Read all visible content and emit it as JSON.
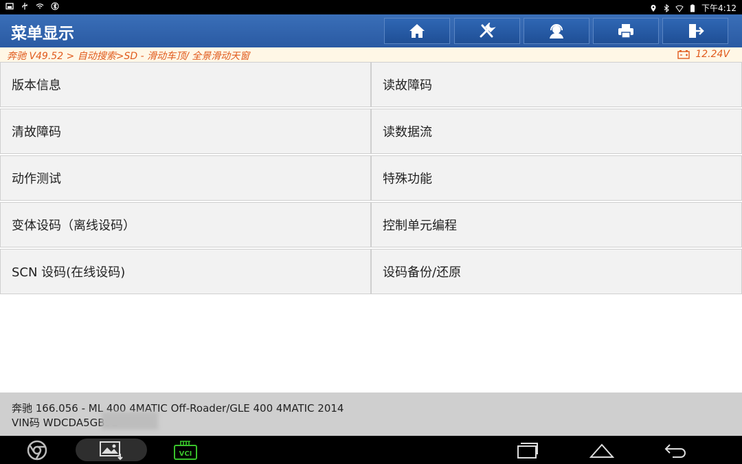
{
  "status_bar": {
    "time": "下午4:12",
    "left_icons": [
      "screenshot-icon",
      "usb-icon",
      "wifi-icon",
      "bluetooth-icon"
    ],
    "right_icons": [
      "location-icon",
      "bluetooth-icon",
      "wifi-icon",
      "battery-icon"
    ]
  },
  "header": {
    "title": "菜单显示",
    "buttons": [
      "home-icon",
      "tools-icon",
      "support-icon",
      "print-icon",
      "exit-icon"
    ]
  },
  "breadcrumb": {
    "path": "奔驰 V49.52 > 自动搜索>SD - 滑动车顶/ 全景滑动天窗",
    "voltage": "12.24V"
  },
  "menu": {
    "items": [
      "版本信息",
      "读故障码",
      "清故障码",
      "读数据流",
      "动作测试",
      "特殊功能",
      "变体设码（离线设码）",
      "控制单元编程",
      "SCN 设码(在线设码)",
      "设码备份/还原"
    ]
  },
  "footer": {
    "vehicle": "奔驰 166.056 - ML 400 4MATIC Off-Roader/GLE 400 4MATIC 2014",
    "vin": "VIN码 WDCDA5GB9E"
  },
  "nav": {
    "vci_label": "VCI"
  },
  "colors": {
    "header_bg": "#2f63ad",
    "breadcrumb_text": "#e05a1c",
    "vci_green": "#39c32b"
  }
}
